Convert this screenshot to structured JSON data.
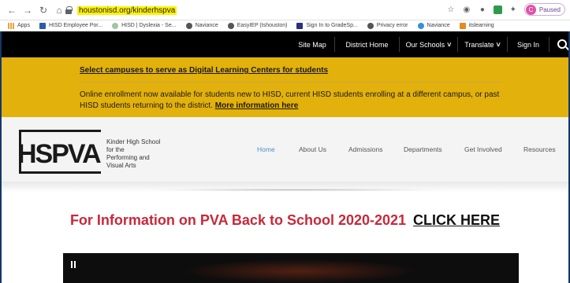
{
  "browser": {
    "url": "houstonisd.org/kinderhspva",
    "profile_initial": "C",
    "profile_status": "Paused",
    "bookmarks": [
      "Apps",
      "HISD Employee Por...",
      "HISD | Dyslexia - Se...",
      "Naviance",
      "EasyIEP (tshouston)",
      "Sign In to GradeSp...",
      "Privacy error",
      "Naviance",
      "itslearning"
    ]
  },
  "site_nav": {
    "items": [
      "Site Map",
      "District Home",
      "Our Schools",
      "Translate",
      "Sign In"
    ],
    "dropdown_mark": "˅"
  },
  "banner": {
    "link": "Select campuses to serve as Digital Learning Centers for students",
    "text": "Online enrollment now available for students new to HISD, current HISD students enrolling at a different campus, or past HISD students returning to the district.",
    "more": "More information here"
  },
  "header": {
    "logo_text": "HSPVA",
    "school_lines": [
      "Kinder High School",
      "for the",
      "Performing and",
      "Visual Arts"
    ],
    "nav": [
      "Home",
      "About Us",
      "Admissions",
      "Departments",
      "Get Involved",
      "Resources"
    ]
  },
  "promo": {
    "text": "For Information on PVA Back to School 2020-2021",
    "link": "CLICK HERE"
  },
  "colors": {
    "banner": "#e3b10c",
    "nav": "#000000",
    "promo_red": "#c8283a",
    "active_nav": "#4a8fd4"
  }
}
